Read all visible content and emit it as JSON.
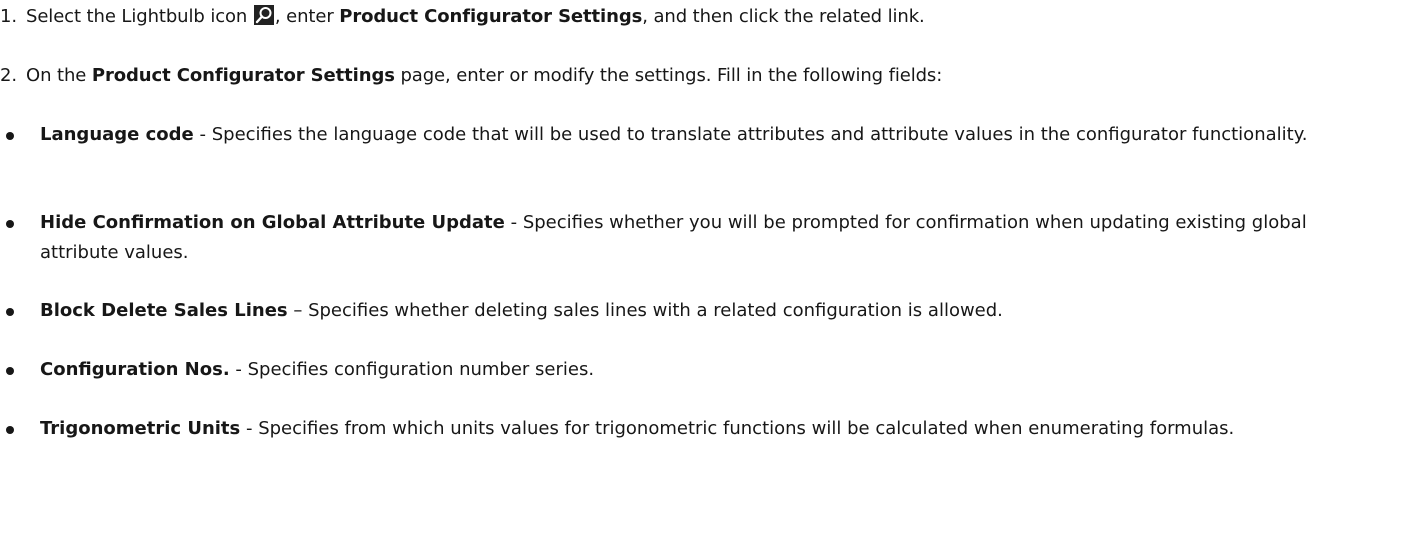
{
  "steps": [
    {
      "num": "1.",
      "prefix": "Select the Lightbulb icon",
      "icon": "lightbulb-search-icon",
      "middle": ", enter",
      "bold": "Product Configurator Settings",
      "suffix": ", and then click the related link."
    },
    {
      "num": "2.",
      "prefix": "On the",
      "bold": "Product Configurator Settings",
      "suffix": "page, enter or modify the settings. Fill in the following fields:"
    }
  ],
  "fields": [
    {
      "name": "Language code",
      "separator": " - ",
      "description": "Specifies the language code that will be used to translate attributes and attribute values in the configurator functionality."
    },
    {
      "name": "Hide Confirmation on Global Attribute Update",
      "separator": " - ",
      "description": "Specifies whether you will be prompted for confirmation when updating existing global attribute values."
    },
    {
      "name": "Block Delete Sales Lines",
      "separator": " – ",
      "description": "Specifies whether deleting sales lines with a related configuration is allowed."
    },
    {
      "name": "Configuration Nos.",
      "separator": " - ",
      "description": "Specifies configuration number series."
    },
    {
      "name": "Trigonometric Units",
      "separator": " - ",
      "description": "Specifies from which units values for trigonometric functions will be calculated when enumerating formulas."
    }
  ]
}
